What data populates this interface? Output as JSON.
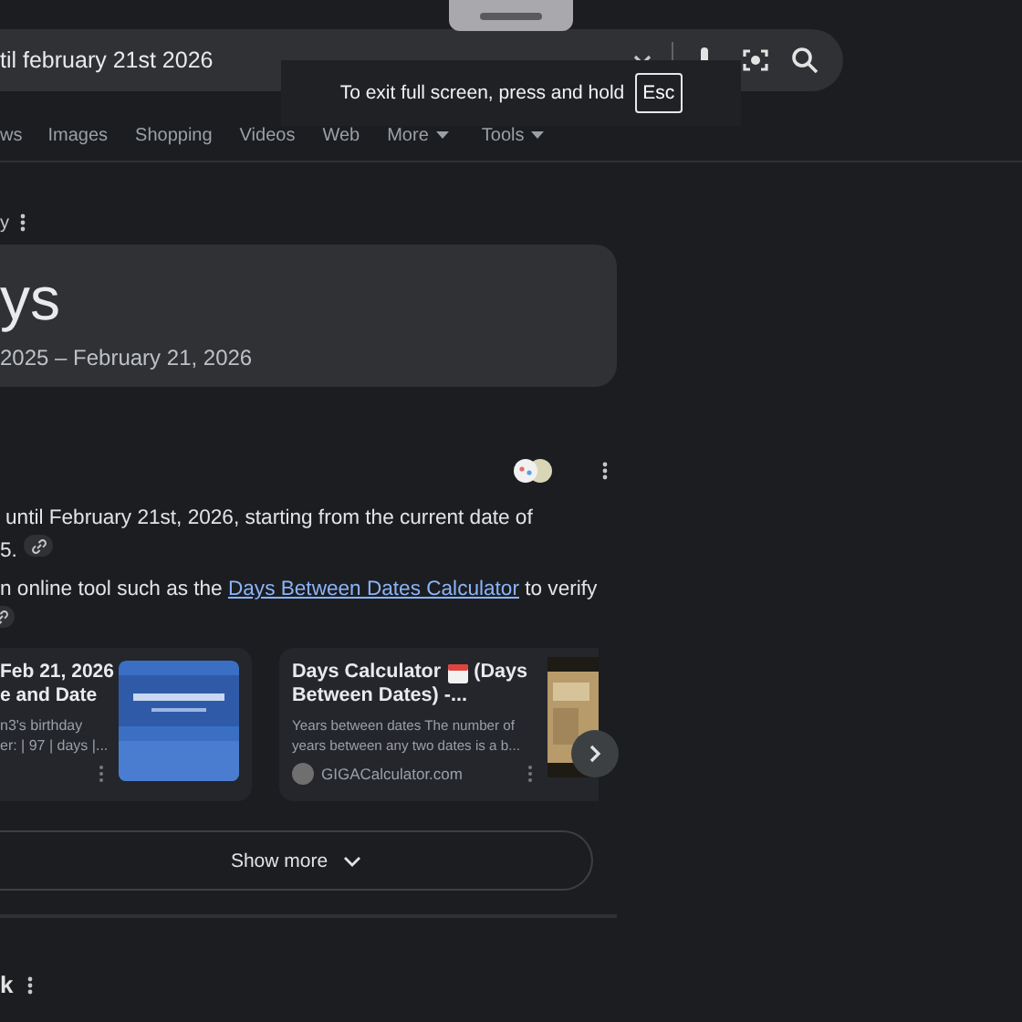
{
  "search": {
    "value": "til february 21st 2026"
  },
  "fullscreen_notice": {
    "text": "To exit full screen, press and hold",
    "key": "Esc"
  },
  "tabs": [
    {
      "label": "ws",
      "selected": false,
      "kind": "plain"
    },
    {
      "label": "Images",
      "selected": false,
      "kind": "plain"
    },
    {
      "label": "Shopping",
      "selected": false,
      "kind": "plain"
    },
    {
      "label": "Videos",
      "selected": false,
      "kind": "plain"
    },
    {
      "label": "Web",
      "selected": false,
      "kind": "plain"
    },
    {
      "label": "More",
      "selected": false,
      "kind": "menu"
    },
    {
      "label": "Tools",
      "selected": false,
      "kind": "menu"
    }
  ],
  "header": {
    "label": "y"
  },
  "answer": {
    "title": "ys",
    "subtitle": "2025 – February 21, 2026"
  },
  "overview": {
    "paragraphs": [
      {
        "text": "until February 21st, 2026, starting from the current date of",
        "text_line2": "5."
      },
      {
        "text": "n online tool such as the ",
        "link": "Days Between Dates Calculator",
        "after": " to verify"
      }
    ]
  },
  "cards": [
    {
      "title": "Feb 21, 2026\ne and Date",
      "snippet": "n3's birthday\ner: | 97 | days |..."
    },
    {
      "title": "Days Calculator",
      "title_after": "(Days",
      "title_line2": "Between Dates) -...",
      "snippet": "Years between dates The number of\nyears between any two dates is a b...",
      "source": "GIGACalculator.com"
    }
  ],
  "show_more": {
    "label": "Show more"
  },
  "next_section": {
    "label": "k"
  }
}
